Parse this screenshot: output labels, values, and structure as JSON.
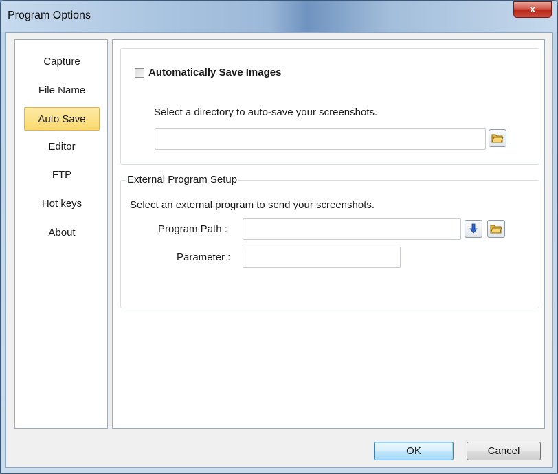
{
  "window": {
    "title": "Program Options",
    "close_glyph": "x"
  },
  "sidebar": {
    "items": [
      {
        "label": "Capture",
        "active": false
      },
      {
        "label": "File Name",
        "active": false
      },
      {
        "label": "Auto Save",
        "active": true
      },
      {
        "label": "Editor",
        "active": false
      },
      {
        "label": "FTP",
        "active": false
      },
      {
        "label": "Hot keys",
        "active": false
      },
      {
        "label": "About",
        "active": false
      }
    ]
  },
  "auto_save": {
    "checkbox_label": "Automatically Save Images",
    "checked": false,
    "description": "Select a directory to auto-save your screenshots.",
    "directory_value": ""
  },
  "external_program": {
    "legend": "External Program Setup",
    "description": "Select an external program to send your screenshots.",
    "program_path_label": "Program Path :",
    "program_path_value": "",
    "parameter_label": "Parameter :",
    "parameter_value": ""
  },
  "footer": {
    "ok_label": "OK",
    "cancel_label": "Cancel"
  },
  "icons": {
    "folder": "folder-open-icon",
    "arrow": "arrow-down-icon",
    "close": "close-icon"
  },
  "colors": {
    "active_nav": "#fbd96e",
    "close_button": "#c94a3a",
    "arrow_blue": "#2a62d1",
    "folder_yellow": "#f2c94c"
  }
}
